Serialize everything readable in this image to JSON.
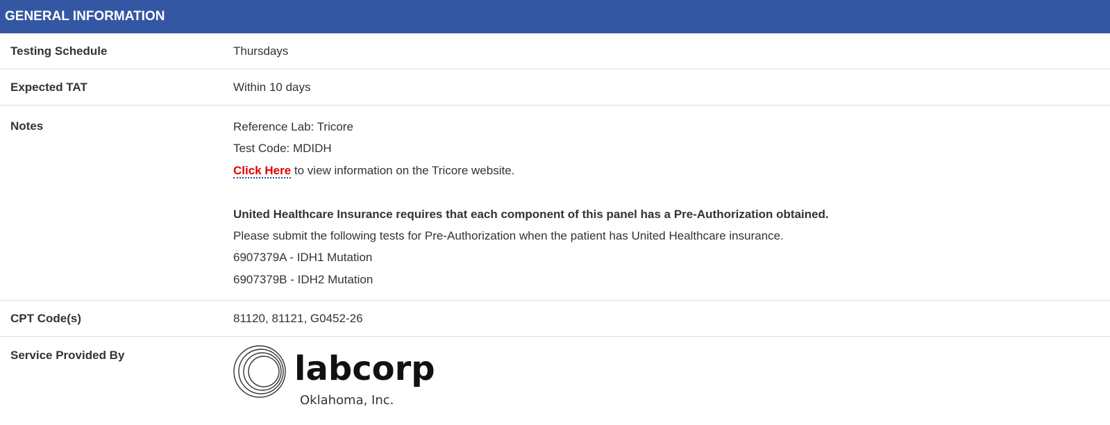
{
  "header": {
    "title": "GENERAL INFORMATION"
  },
  "rows": {
    "testing_schedule": {
      "label": "Testing Schedule",
      "value": "Thursdays"
    },
    "expected_tat": {
      "label": "Expected TAT",
      "value": "Within 10 days"
    },
    "notes": {
      "label": "Notes",
      "reference_lab": "Reference Lab: Tricore",
      "test_code": "Test Code: MDIDH",
      "link_text": "Click Here",
      "link_suffix": " to view information on the Tricore website.",
      "insurance_bold": "United Healthcare Insurance requires that each component of this panel has a Pre-Authorization obtained.",
      "insurance_instructions": "Please submit the following tests for Pre-Authorization when the patient has United Healthcare insurance.",
      "test_a": "6907379A - IDH1 Mutation",
      "test_b": "6907379B - IDH2 Mutation"
    },
    "cpt_codes": {
      "label": "CPT Code(s)",
      "value": "81120, 81121, G0452-26"
    },
    "service_provided_by": {
      "label": "Service Provided By",
      "logo_name": "labcorp",
      "logo_subtitle": "Oklahoma, Inc."
    }
  },
  "colors": {
    "header_bg": "#3457a3",
    "link": "#e00000",
    "divider": "#dddddd"
  }
}
